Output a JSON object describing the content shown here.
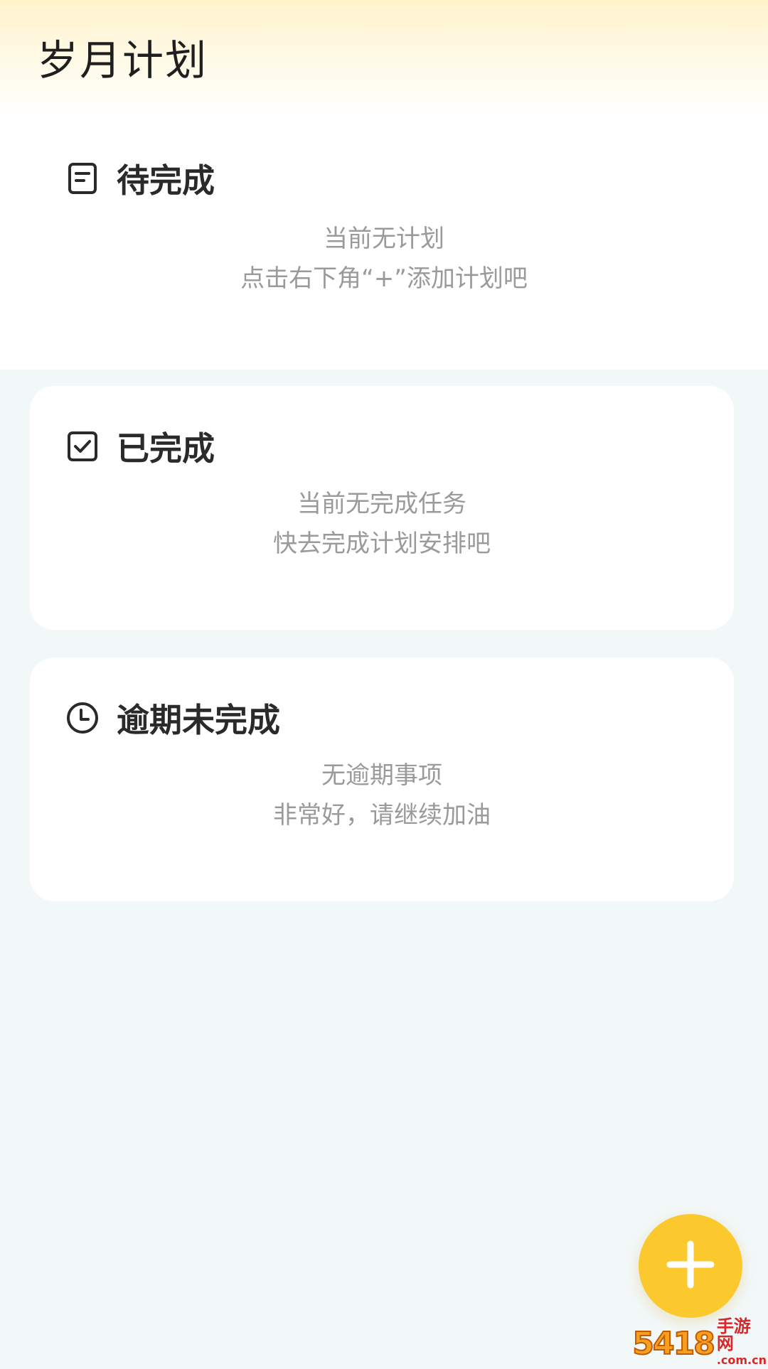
{
  "header": {
    "title": "岁月计划"
  },
  "cards": {
    "pending": {
      "title": "待完成",
      "line1": "当前无计划",
      "line2": "点击右下角“+”添加计划吧",
      "icon": "document-icon"
    },
    "done": {
      "title": "已完成",
      "line1": "当前无完成任务",
      "line2": "快去完成计划安排吧",
      "icon": "checkbox-icon"
    },
    "overdue": {
      "title": "逾期未完成",
      "line1": "无逾期事项",
      "line2": "非常好，请继续加油",
      "icon": "clock-icon"
    }
  },
  "fab": {
    "icon": "plus-icon",
    "color": "#fbc92e"
  },
  "watermark": {
    "number": "5418",
    "text": "手游网",
    "domain": ".com.cn"
  }
}
